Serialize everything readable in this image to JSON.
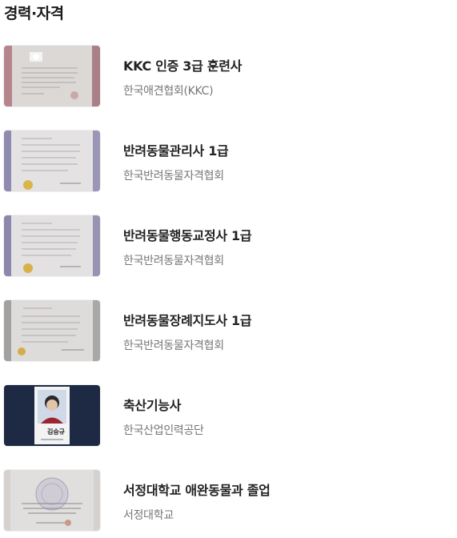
{
  "section": {
    "title": "경력·자격"
  },
  "items": [
    {
      "title": "KKC 인증 3급 훈련사",
      "issuer": "한국애견협회(KKC)",
      "thumb_icon": "certificate-photo-icon"
    },
    {
      "title": "반려동물관리사 1급",
      "issuer": "한국반려동물자격협회",
      "thumb_icon": "certificate-photo-icon"
    },
    {
      "title": "반려동물행동교정사 1급",
      "issuer": "한국반려동물자격협회",
      "thumb_icon": "certificate-photo-icon"
    },
    {
      "title": "반려동물장례지도사 1급",
      "issuer": "한국반려동물자격협회",
      "thumb_icon": "certificate-photo-icon"
    },
    {
      "title": "축산기능사",
      "issuer": "한국산업인력공단",
      "thumb_icon": "license-card-photo-icon",
      "card_name": "김승규"
    },
    {
      "title": "서정대학교 애완동물과 졸업",
      "issuer": "서정대학교",
      "thumb_icon": "diploma-photo-icon"
    }
  ]
}
